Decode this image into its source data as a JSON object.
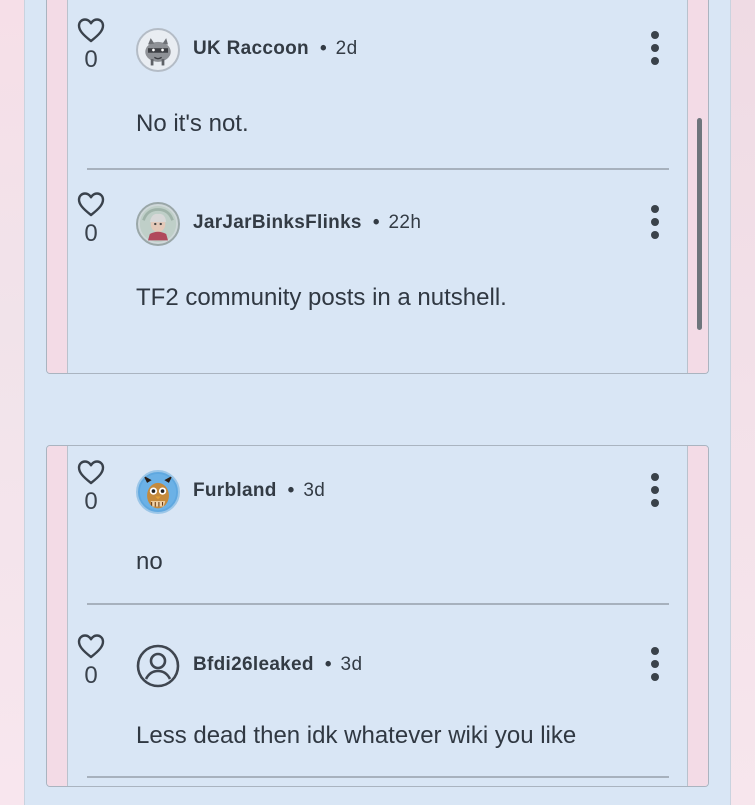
{
  "threads": [
    {
      "replies": [
        {
          "username": "UK Raccoon",
          "time": "2d",
          "likes": "0",
          "text": "No it's not.",
          "avatar_icon": "raccoon-avatar-icon"
        },
        {
          "username": "JarJarBinksFlinks",
          "time": "22h",
          "likes": "0",
          "text": "TF2 community posts in a nutshell.",
          "avatar_icon": "portrait-avatar-icon"
        }
      ]
    },
    {
      "replies": [
        {
          "username": "Furbland",
          "time": "3d",
          "likes": "0",
          "text": "no",
          "avatar_icon": "furby-avatar-icon"
        },
        {
          "username": "Bfdi26leaked",
          "time": "3d",
          "likes": "0",
          "text": "Less dead then idk whatever wiki you like",
          "avatar_icon": "default-user-icon"
        }
      ]
    }
  ],
  "separator": "•",
  "colors": {
    "column_bg": "#d9e6f5",
    "stripe_pink": "#f3dbe6",
    "border": "#aab4c0",
    "text": "#303842"
  }
}
